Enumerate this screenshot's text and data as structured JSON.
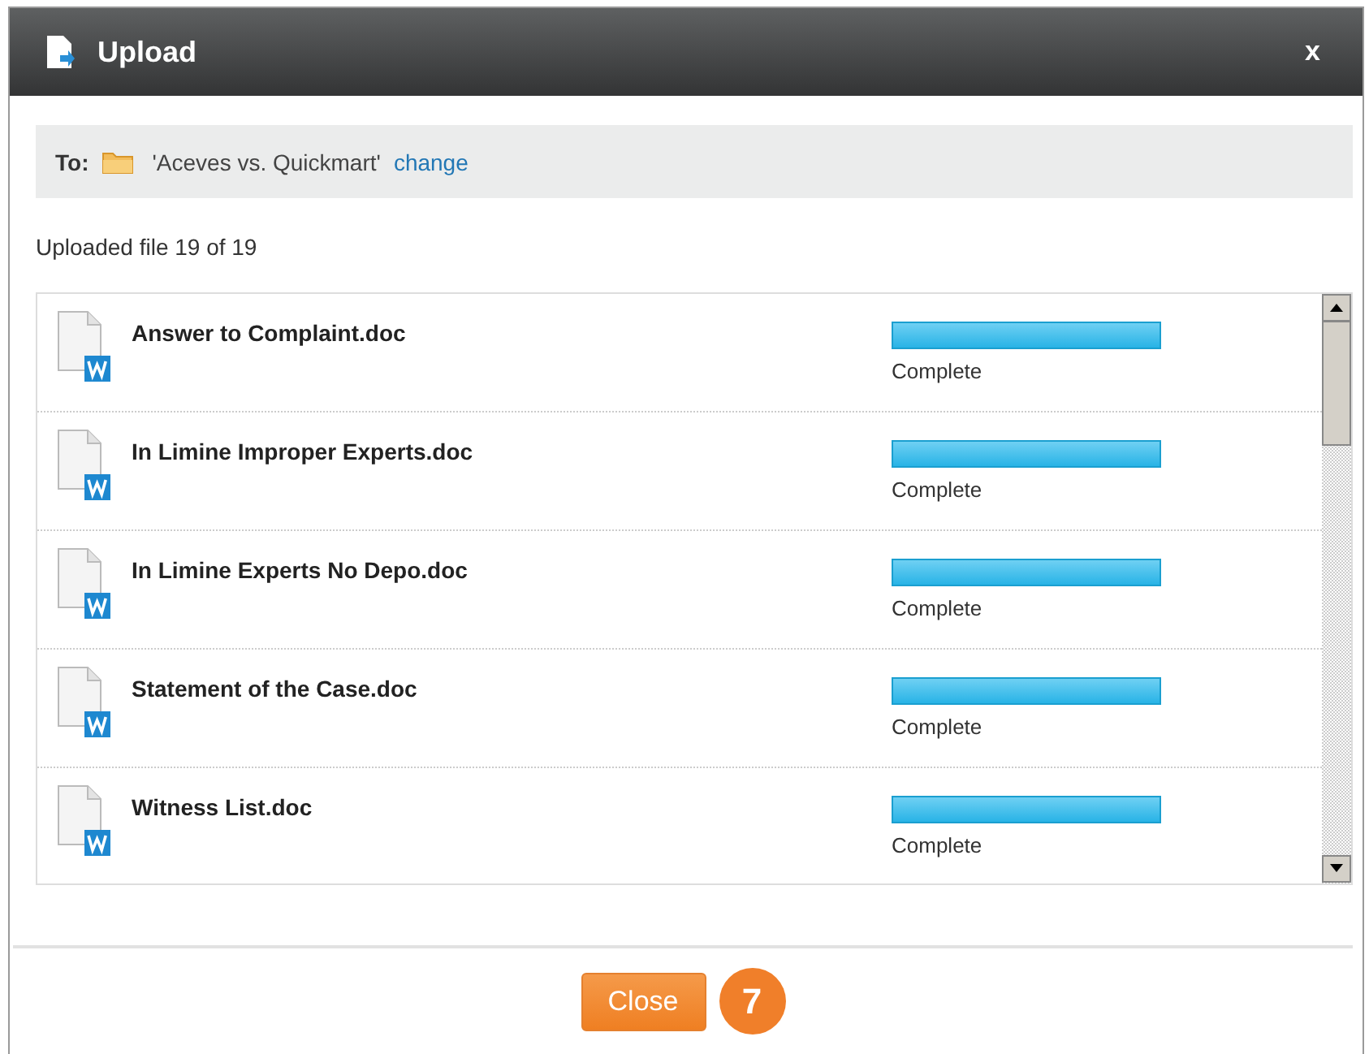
{
  "window": {
    "title": "Upload",
    "close": "x"
  },
  "destination": {
    "label": "To:",
    "folder": "'Aceves vs. Quickmart'",
    "change_link": "change"
  },
  "status": "Uploaded file 19 of 19",
  "files": [
    {
      "name": "Answer to Complaint.doc",
      "level": 1,
      "state": "Complete"
    },
    {
      "name": "In Limine Improper Experts.doc",
      "level": 1,
      "state": "Complete"
    },
    {
      "name": "In Limine Experts No Depo.doc",
      "level": 1,
      "state": "Complete"
    },
    {
      "name": "Statement of the Case.doc",
      "level": 1,
      "state": "Complete"
    },
    {
      "name": "Witness List.doc",
      "level": 1,
      "state": "Complete"
    }
  ],
  "buttons": [
    "Close"
  ],
  "step_badge": "7"
}
